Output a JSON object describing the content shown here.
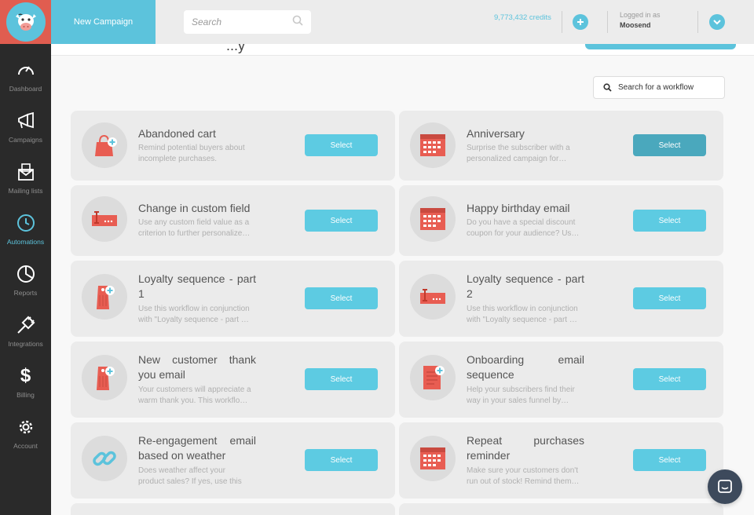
{
  "header": {
    "new_campaign": "New Campaign",
    "search_placeholder": "Search",
    "credits": "9,773,432 credits",
    "logged_in_label": "Logged in as",
    "username": "Moosend"
  },
  "sidebar": {
    "items": [
      {
        "label": "Dashboard",
        "icon": "dashboard-icon",
        "active": false
      },
      {
        "label": "Campaigns",
        "icon": "megaphone-icon",
        "active": false
      },
      {
        "label": "Mailing lists",
        "icon": "mailing-list-icon",
        "active": false
      },
      {
        "label": "Automations",
        "icon": "automation-clock-icon",
        "active": true
      },
      {
        "label": "Reports",
        "icon": "reports-pie-icon",
        "active": false
      },
      {
        "label": "Integrations",
        "icon": "integrations-plug-icon",
        "active": false
      },
      {
        "label": "Billing",
        "icon": "dollar-icon",
        "active": false
      },
      {
        "label": "Account",
        "icon": "gear-icon",
        "active": false
      }
    ]
  },
  "page": {
    "partial_title": "...y",
    "workflow_search_placeholder": "Search for a workflow"
  },
  "workflows": [
    {
      "title": "Abandoned cart",
      "desc": "Remind potential buyers about incomplete purchases.",
      "icon": "shopping-bag-icon",
      "select": "Select"
    },
    {
      "title": "Anniversary",
      "desc": "Surprise the subscriber with a personalized campaign for…",
      "icon": "calendar-icon",
      "select": "Select"
    },
    {
      "title": "Change in custom field",
      "desc": "Use any custom field value as a criterion to further personalize…",
      "icon": "input-field-icon",
      "select": "Select"
    },
    {
      "title": "Happy birthday email",
      "desc": "Do you have a special discount coupon for your audience? Us…",
      "icon": "calendar-icon",
      "select": "Select"
    },
    {
      "title": "Loyalty sequence - part 1",
      "desc": "Use this workflow in conjunction with \"Loyalty sequence - part …",
      "icon": "price-tag-icon",
      "select": "Select"
    },
    {
      "title": "Loyalty sequence - part 2",
      "desc": "Use this workflow in conjunction with \"Loyalty sequence - part …",
      "icon": "input-field-icon",
      "select": "Select"
    },
    {
      "title": "New customer thank you email",
      "desc": "Your customers will appreciate a warm thank you. This workflo…",
      "icon": "price-tag-icon",
      "select": "Select"
    },
    {
      "title": "Onboarding email sequence",
      "desc": "Help your subscribers find their way in your sales funnel by…",
      "icon": "document-add-icon",
      "select": "Select"
    },
    {
      "title": "Re-engagement email based on weather",
      "desc": "Does weather affect your product sales? If yes, use this",
      "icon": "link-icon",
      "select": "Select"
    },
    {
      "title": "Repeat purchases reminder",
      "desc": "Make sure your customers don't run out of stock! Remind them…",
      "icon": "calendar-icon",
      "select": "Select"
    }
  ]
}
